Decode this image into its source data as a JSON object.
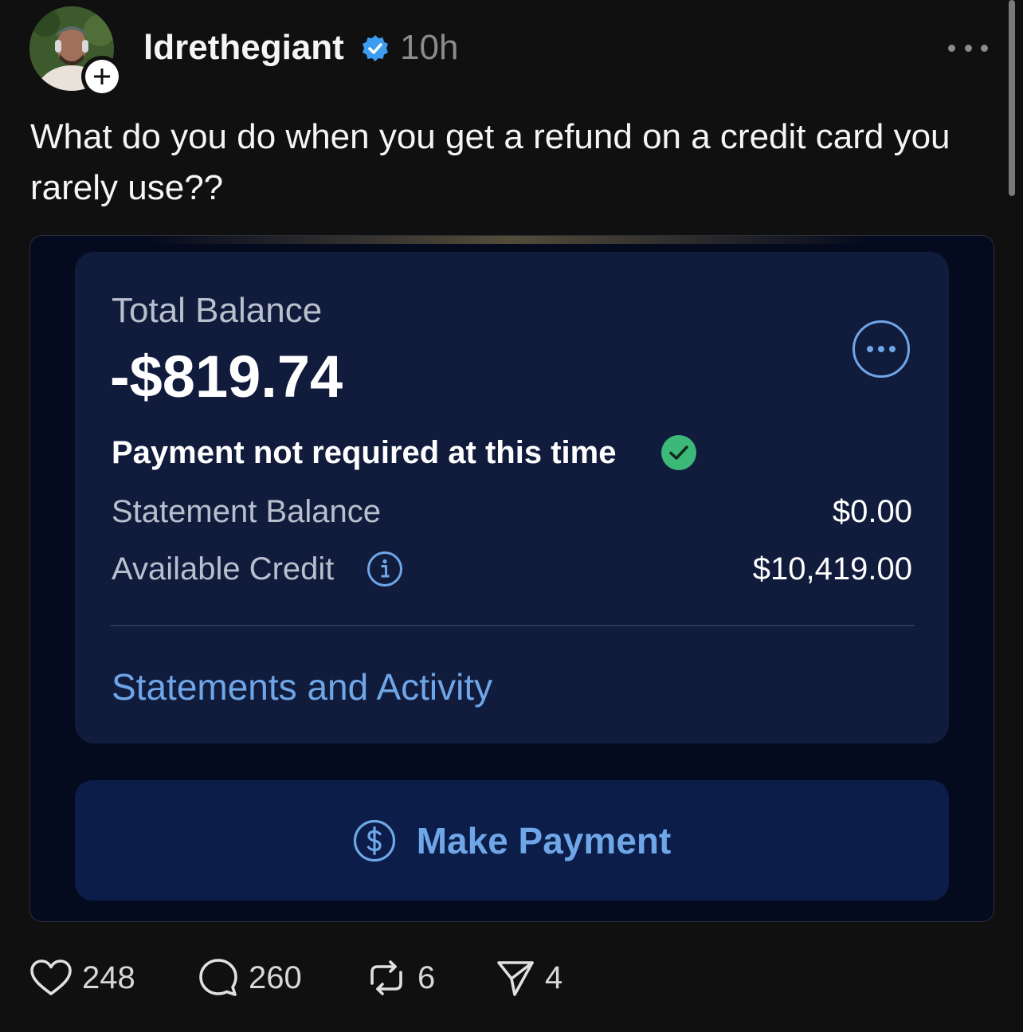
{
  "post": {
    "username": "ldrethegiant",
    "timestamp": "10h",
    "caption": "What do you do when you get a refund on a credit card you rarely use??"
  },
  "card": {
    "total_balance_label": "Total Balance",
    "total_balance_value": "-$819.74",
    "payment_status": "Payment not required at this time",
    "statement_balance_label": "Statement Balance",
    "statement_balance_value": "$0.00",
    "available_credit_label": "Available Credit",
    "available_credit_value": "$10,419.00",
    "statements_link": "Statements and Activity",
    "make_payment_label": "Make Payment"
  },
  "actions": {
    "likes": "248",
    "comments": "260",
    "reposts": "6",
    "shares": "4"
  },
  "colors": {
    "background": "#101010",
    "panel": "#111c3d",
    "accent_blue": "#6fa6e8",
    "verified_blue": "#3b9cf0",
    "success_green": "#3cb878"
  },
  "icons": [
    "plus-icon",
    "verified-badge-icon",
    "more-icon",
    "ellipsis-circle-icon",
    "checkmark-icon",
    "info-icon",
    "dollar-icon",
    "heart-icon",
    "comment-icon",
    "repost-icon",
    "share-icon"
  ]
}
